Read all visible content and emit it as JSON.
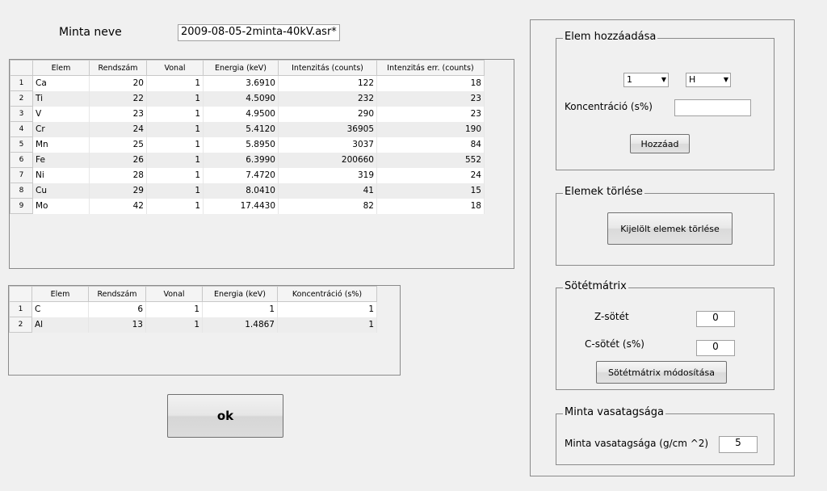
{
  "sample": {
    "label": "Minta neve",
    "name": "2009-08-05-2minta-40kV.asr*"
  },
  "table1": {
    "columns": [
      "Elem",
      "Rendszám",
      "Vonal",
      "Energia (keV)",
      "Intenzitás (counts)",
      "Intenzitás err. (counts)"
    ],
    "rows": [
      [
        "Ca",
        "20",
        "1",
        "3.6910",
        "122",
        "18"
      ],
      [
        "Ti",
        "22",
        "1",
        "4.5090",
        "232",
        "23"
      ],
      [
        "V",
        "23",
        "1",
        "4.9500",
        "290",
        "23"
      ],
      [
        "Cr",
        "24",
        "1",
        "5.4120",
        "36905",
        "190"
      ],
      [
        "Mn",
        "25",
        "1",
        "5.8950",
        "3037",
        "84"
      ],
      [
        "Fe",
        "26",
        "1",
        "6.3990",
        "200660",
        "552"
      ],
      [
        "Ni",
        "28",
        "1",
        "7.4720",
        "319",
        "24"
      ],
      [
        "Cu",
        "29",
        "1",
        "8.0410",
        "41",
        "15"
      ],
      [
        "Mo",
        "42",
        "1",
        "17.4430",
        "82",
        "18"
      ]
    ]
  },
  "table2": {
    "columns": [
      "Elem",
      "Rendszám",
      "Vonal",
      "Energia (keV)",
      "Koncentráció (s%)"
    ],
    "rows": [
      [
        "C",
        "6",
        "1",
        "1",
        "1"
      ],
      [
        "Al",
        "13",
        "1",
        "1.4867",
        "1"
      ]
    ]
  },
  "ok_button": "ok",
  "add_group": {
    "title": "Elem hozzáadása",
    "count_select": "1",
    "element_select": "H",
    "conc_label": "Koncentráció  (s%)",
    "conc_value": "",
    "add_button": "Hozzáad"
  },
  "delete_group": {
    "title": "Elemek törlése",
    "delete_button": "Kijelölt elemek törlése"
  },
  "matrix_group": {
    "title": "Sötétmátrix",
    "z_label": "Z-sötét",
    "z_value": "0",
    "c_label": "C-sötét  (s%)",
    "c_value": "0",
    "modify_button": "Sötétmátrix módosítása"
  },
  "thickness_group": {
    "title": "Minta vasatagsága",
    "label": "Minta vasatagsága (g/cm ^2)",
    "value": "5"
  }
}
